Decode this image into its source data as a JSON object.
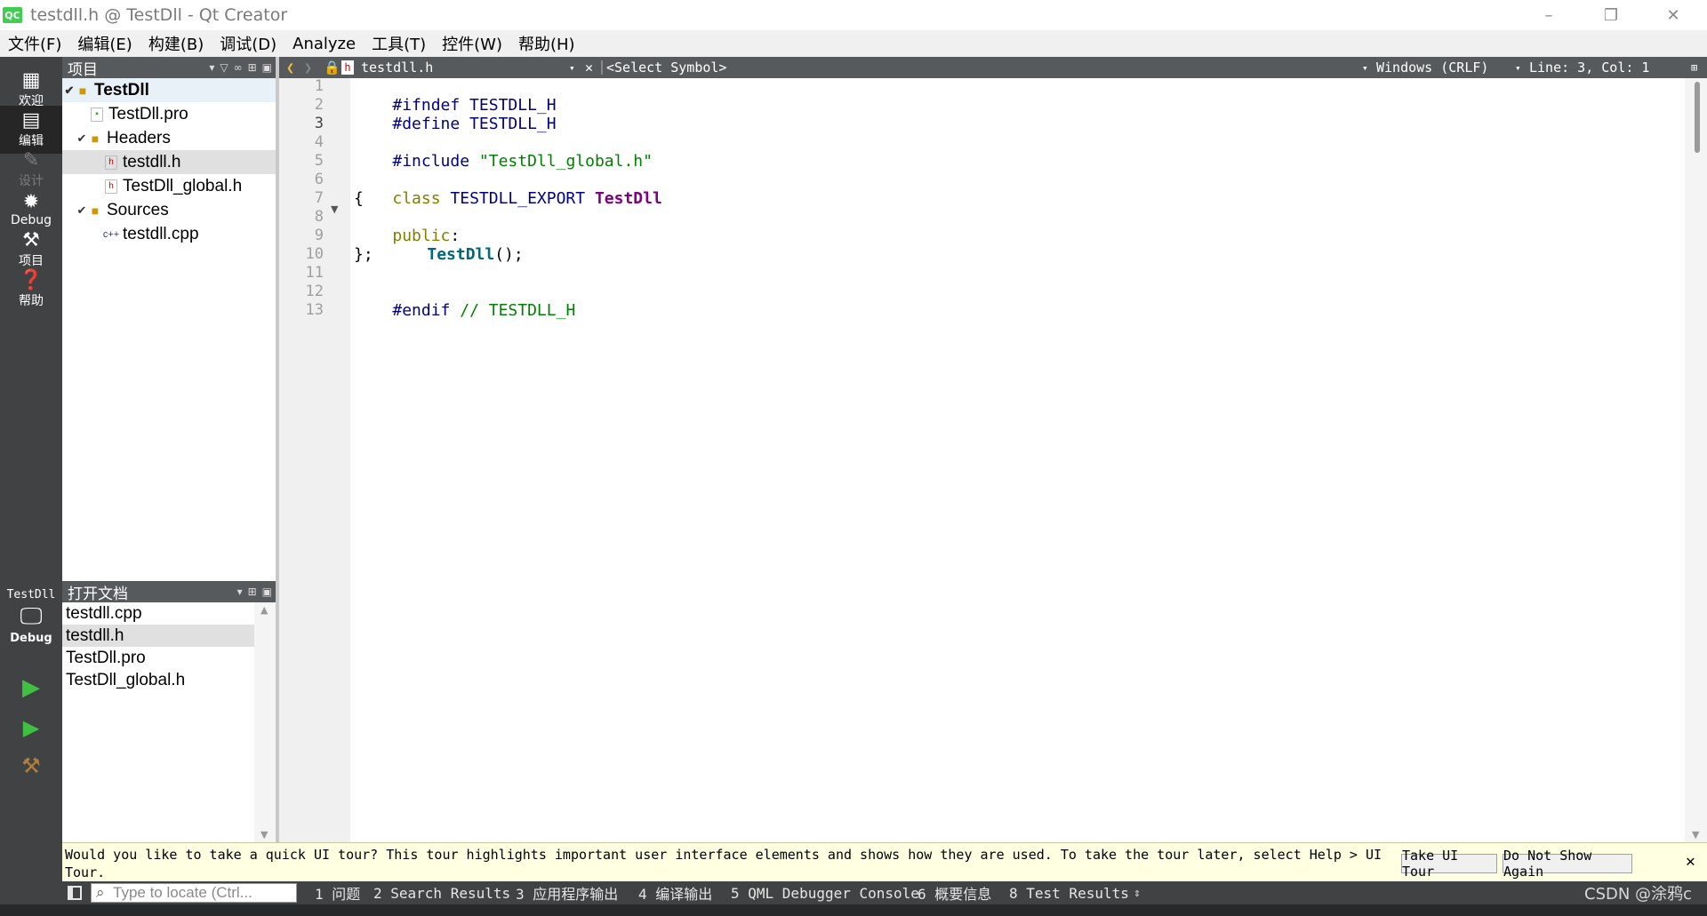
{
  "window": {
    "title": "testdll.h @ TestDll - Qt Creator",
    "app_icon": "QC"
  },
  "menu": [
    "文件(F)",
    "编辑(E)",
    "构建(B)",
    "调试(D)",
    "Analyze",
    "工具(T)",
    "控件(W)",
    "帮助(H)"
  ],
  "modes": [
    {
      "label": "欢迎",
      "icon": "grid-icon"
    },
    {
      "label": "编辑",
      "icon": "edit-icon",
      "active": true
    },
    {
      "label": "设计",
      "icon": "pencil-icon",
      "disabled": true
    },
    {
      "label": "Debug",
      "icon": "bug-icon"
    },
    {
      "label": "项目",
      "icon": "wrench-icon"
    },
    {
      "label": "帮助",
      "icon": "help-icon"
    }
  ],
  "kit": {
    "project": "TestDll",
    "build": "Debug"
  },
  "project_pane": {
    "title": "项目",
    "tree": [
      {
        "label": "TestDll",
        "kind": "root"
      },
      {
        "label": "TestDll.pro",
        "kind": "pro"
      },
      {
        "label": "Headers",
        "kind": "folder"
      },
      {
        "label": "testdll.h",
        "kind": "h"
      },
      {
        "label": "TestDll_global.h",
        "kind": "h"
      },
      {
        "label": "Sources",
        "kind": "folder"
      },
      {
        "label": "testdll.cpp",
        "kind": "cpp"
      }
    ]
  },
  "open_docs": {
    "title": "打开文档",
    "items": [
      "testdll.cpp",
      "testdll.h",
      "TestDll.pro",
      "TestDll_global.h"
    ]
  },
  "editor_toolbar": {
    "file": "testdll.h",
    "symbol": "<Select Symbol>",
    "line_ending": "Windows (CRLF)",
    "position": "Line: 3, Col: 1"
  },
  "editor": {
    "current_line": 3,
    "line_numbers": [
      "1",
      "2",
      "3",
      "4",
      "5",
      "6",
      "7",
      "8",
      "9",
      "10",
      "11",
      "12",
      "13"
    ],
    "l1": {
      "kw": "#ifndef",
      "rest": " TESTDLL_H"
    },
    "l2": {
      "kw": "#define",
      "rest": " TESTDLL_H"
    },
    "l4": {
      "kw": "#include",
      "str": "\"TestDll_global.h\""
    },
    "l6": {
      "kw": "class",
      "macro": "TESTDLL_EXPORT",
      "name": "TestDll"
    },
    "l7": "{",
    "l8": {
      "kw": "public",
      "rest": ":"
    },
    "l9": {
      "fn": "TestDll",
      "rest": "();"
    },
    "l10": "};",
    "l12": {
      "kw": "#endif",
      "cm": "// TESTDLL_H"
    }
  },
  "infobar": {
    "message": "Would you like to take a quick UI tour? This tour highlights important user interface elements and shows how they are used. To take the tour later, select Help > UI Tour.",
    "take_tour": "Take UI Tour",
    "dont_show": "Do Not Show Again"
  },
  "statusbar": {
    "locator_placeholder": "Type to locate (Ctrl...",
    "panes": [
      "1 问题",
      "2 Search Results",
      "3 应用程序输出",
      "4 编译输出",
      "5 QML Debugger Console",
      "6 概要信息",
      "8 Test Results"
    ],
    "watermark": "CSDN @涂鸦c"
  }
}
